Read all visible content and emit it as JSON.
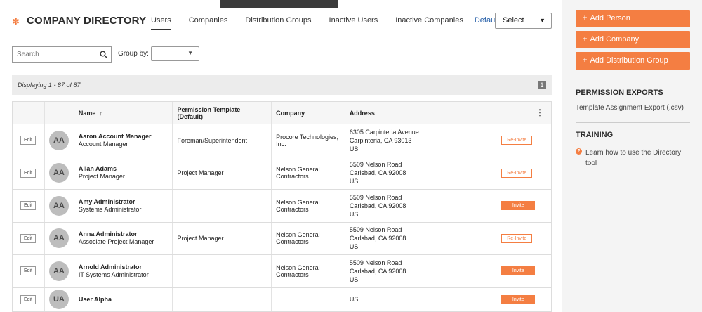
{
  "header": {
    "title": "COMPANY DIRECTORY",
    "tabs": [
      "Users",
      "Companies",
      "Distribution Groups",
      "Inactive Users",
      "Inactive Companies"
    ],
    "default_view": "Default View",
    "select_value": "Select"
  },
  "filters": {
    "search_placeholder": "Search",
    "group_by_label": "Group by:"
  },
  "count": {
    "text": "Displaying 1 - 87 of 87",
    "page": "1"
  },
  "table": {
    "columns": [
      "Name",
      "Permission Template (Default)",
      "Company",
      "Address"
    ],
    "sort_arrow": "↑",
    "edit_label": "Edit",
    "rows": [
      {
        "initials": "AA",
        "name": "Aaron Account Manager",
        "title": "Account Manager",
        "template": "Foreman/Superintendent",
        "company": "Procore Technologies, Inc.",
        "addr1": "6305 Carpinteria Avenue",
        "addr2": "Carpinteria, CA 93013",
        "addr3": "US",
        "action": "Re-Invite"
      },
      {
        "initials": "AA",
        "name": "Allan Adams",
        "title": "Project Manager",
        "template": "Project Manager",
        "company": "Nelson General Contractors",
        "addr1": "5509 Nelson Road",
        "addr2": "Carlsbad, CA 92008",
        "addr3": "US",
        "action": "Re-Invite"
      },
      {
        "initials": "AA",
        "name": "Amy Administrator",
        "title": "Systems Administrator",
        "template": "",
        "company": "Nelson General Contractors",
        "addr1": "5509 Nelson Road",
        "addr2": "Carlsbad, CA 92008",
        "addr3": "US",
        "action": "Invite"
      },
      {
        "initials": "AA",
        "name": "Anna Administrator",
        "title": "Associate Project Manager",
        "template": "Project Manager",
        "company": "Nelson General Contractors",
        "addr1": "5509 Nelson Road",
        "addr2": "Carlsbad, CA 92008",
        "addr3": "US",
        "action": "Re-Invite"
      },
      {
        "initials": "AA",
        "name": "Arnold Administrator",
        "title": "IT Systems Administrator",
        "template": "",
        "company": "Nelson General Contractors",
        "addr1": "5509 Nelson Road",
        "addr2": "Carlsbad, CA 92008",
        "addr3": "US",
        "action": "Invite"
      },
      {
        "initials": "UA",
        "name": "User Alpha",
        "title": "",
        "template": "",
        "company": "",
        "addr1": "",
        "addr2": "US",
        "addr3": "",
        "action": "Invite"
      }
    ]
  },
  "sidebar": {
    "buttons": [
      "Add Person",
      "Add Company",
      "Add Distribution Group"
    ],
    "permission_exports_heading": "PERMISSION EXPORTS",
    "permission_exports_link": "Template Assignment Export (.csv)",
    "training_heading": "TRAINING",
    "training_link": "Learn how to use the Directory tool"
  },
  "colors": {
    "accent": "#f47e42",
    "link": "#1f5aa6",
    "sidebar_bg": "#f4f4f4"
  }
}
